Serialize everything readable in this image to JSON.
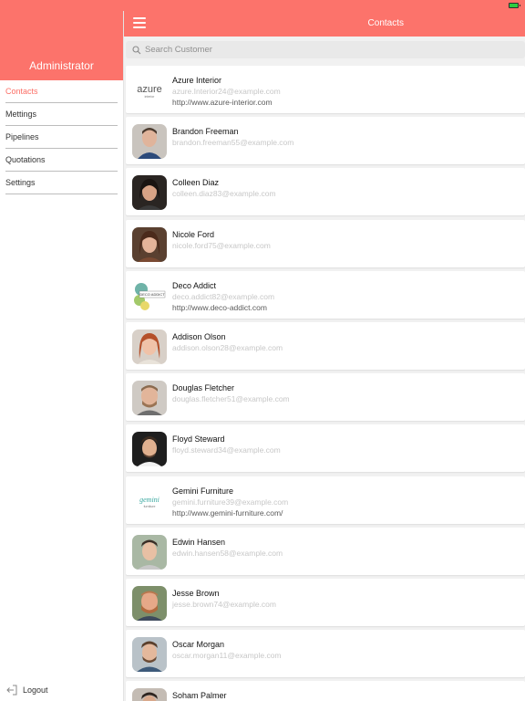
{
  "sidebar": {
    "title": "Administrator",
    "items": [
      {
        "label": "Contacts",
        "active": true
      },
      {
        "label": "Mettings",
        "active": false
      },
      {
        "label": "Pipelines",
        "active": false
      },
      {
        "label": "Quotations",
        "active": false
      },
      {
        "label": "Settings",
        "active": false
      }
    ],
    "logout_label": "Logout"
  },
  "header": {
    "title": "Contacts"
  },
  "search": {
    "placeholder": "Search Customer"
  },
  "logos": {
    "azure": {
      "word": "azure",
      "sub": "interior"
    },
    "deco": {
      "word": "DECO ADDICT"
    },
    "gemini": {
      "word": "gemini",
      "sub": "furniture"
    }
  },
  "contacts": [
    {
      "name": "Azure Interior",
      "email": "azure.Interior24@example.com",
      "website": "http://www.azure-interior.com",
      "avatar": "azure-logo"
    },
    {
      "name": "Brandon Freeman",
      "email": "brandon.freeman55@example.com",
      "website": "",
      "avatar": "person"
    },
    {
      "name": "Colleen Diaz",
      "email": "colleen.diaz83@example.com",
      "website": "",
      "avatar": "person"
    },
    {
      "name": "Nicole Ford",
      "email": "nicole.ford75@example.com",
      "website": "",
      "avatar": "person"
    },
    {
      "name": "Deco Addict",
      "email": "deco.addict82@example.com",
      "website": "http://www.deco-addict.com",
      "avatar": "deco-logo"
    },
    {
      "name": "Addison Olson",
      "email": "addison.olson28@example.com",
      "website": "",
      "avatar": "person"
    },
    {
      "name": "Douglas Fletcher",
      "email": "douglas.fletcher51@example.com",
      "website": "",
      "avatar": "person"
    },
    {
      "name": "Floyd Steward",
      "email": "floyd.steward34@example.com",
      "website": "",
      "avatar": "person"
    },
    {
      "name": "Gemini Furniture",
      "email": "gemini.furniture39@example.com",
      "website": "http://www.gemini-furniture.com/",
      "avatar": "gemini-logo"
    },
    {
      "name": "Edwin Hansen",
      "email": "edwin.hansen58@example.com",
      "website": "",
      "avatar": "person"
    },
    {
      "name": "Jesse Brown",
      "email": "jesse.brown74@example.com",
      "website": "",
      "avatar": "person"
    },
    {
      "name": "Oscar Morgan",
      "email": "oscar.morgan11@example.com",
      "website": "",
      "avatar": "person"
    },
    {
      "name": "Soham Palmer",
      "email": "",
      "website": "",
      "avatar": "person"
    }
  ],
  "colors": {
    "accent": "#fc736b",
    "active_menu": "#fc6f66",
    "email_text": "#c7c7c7",
    "list_bg": "#f1f1f1"
  }
}
